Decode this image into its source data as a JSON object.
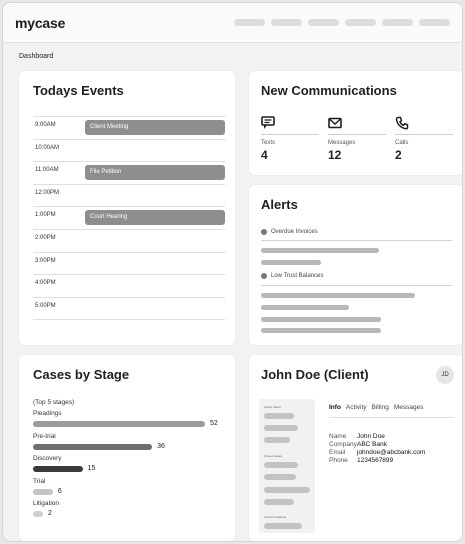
{
  "app": {
    "logo": "mycase"
  },
  "breadcrumb": "Dashboard",
  "events": {
    "title": "Todays Events",
    "slots": [
      {
        "time": "9:00AM",
        "event": "Client Meeting"
      },
      {
        "time": "10:00AM",
        "event": ""
      },
      {
        "time": "11:00AM",
        "event": "File Petition"
      },
      {
        "time": "12:00PM",
        "event": ""
      },
      {
        "time": "1:00PM",
        "event": "Court Hearing"
      },
      {
        "time": "2:00PM",
        "event": ""
      },
      {
        "time": "3:00PM",
        "event": ""
      },
      {
        "time": "4:00PM",
        "event": ""
      },
      {
        "time": "5:00PM",
        "event": ""
      }
    ]
  },
  "communications": {
    "title": "New Communications",
    "items": [
      {
        "label": "Texts",
        "count": "4",
        "icon": "chat-icon"
      },
      {
        "label": "Messages",
        "count": "12",
        "icon": "envelope-icon"
      },
      {
        "label": "Calls",
        "count": "2",
        "icon": "phone-icon"
      }
    ]
  },
  "alerts": {
    "title": "Alerts",
    "groups": [
      {
        "label": "Overdue Invoices"
      },
      {
        "label": "Low Trust Balances"
      }
    ]
  },
  "cases": {
    "title": "Cases by Stage",
    "subtitle": "(Top 5 stages)",
    "stages": [
      {
        "name": "Pleadings",
        "count": 52,
        "color": "#9a9a9a"
      },
      {
        "name": "Pre-trial",
        "count": 36,
        "color": "#6f6f6f"
      },
      {
        "name": "Discovery",
        "count": 15,
        "color": "#3a3a3a"
      },
      {
        "name": "Trial",
        "count": 6,
        "color": "#c4c4c4"
      },
      {
        "name": "Litigation",
        "count": 2,
        "color": "#cfcfcf"
      }
    ]
  },
  "client": {
    "title": "John Doe (Client)",
    "initials": "JD",
    "side_headers": [
      "Active cases",
      "Closed cases",
      "Account balance"
    ],
    "tabs": [
      "Info",
      "Activity",
      "Billing",
      "Messages"
    ],
    "active_tab": "Info",
    "info": [
      {
        "key": "Name",
        "value": "John Doe"
      },
      {
        "key": "Company",
        "value": "ABC Bank"
      },
      {
        "key": "Email",
        "value": "johndoe@abcbank.com"
      },
      {
        "key": "Phone",
        "value": "1234567899"
      }
    ]
  }
}
